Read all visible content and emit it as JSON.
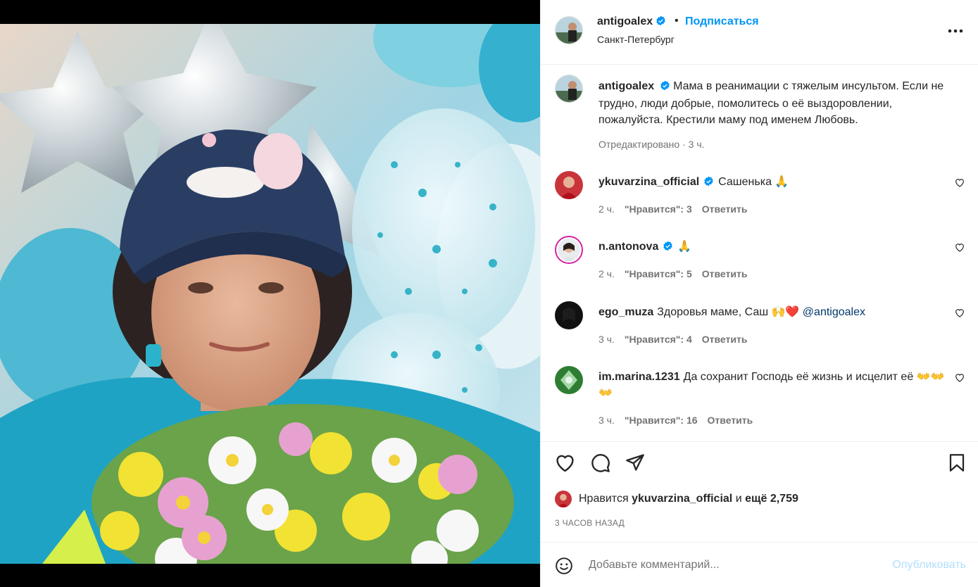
{
  "post": {
    "author": "antigoalex",
    "follow_label": "Подписаться",
    "separator": "•",
    "location": "Санкт-Петербург",
    "more_icon": "more-horizontal-icon"
  },
  "caption": {
    "author": "antigoalex",
    "text": "Мама в реанимации с тяжелым инсультом. Если не трудно, люди добрые, помолитесь о её выздоровлении, пожалуйста. Крестили маму под именем Любовь.",
    "edited": "Отредактировано",
    "dot": "·",
    "time": "3 ч."
  },
  "comments": [
    {
      "author": "ykuvarzina_official",
      "verified": true,
      "text": "Сашенька 🙏",
      "time": "2 ч.",
      "likes": "\"Нравится\": 3",
      "reply": "Ответить"
    },
    {
      "author": "n.antonova",
      "verified": true,
      "text": "🙏",
      "time": "2 ч.",
      "likes": "\"Нравится\": 5",
      "reply": "Ответить"
    },
    {
      "author": "ego_muza",
      "verified": false,
      "text": "Здоровья маме, Саш 🙌❤️",
      "mention": "@antigoalex",
      "time": "3 ч.",
      "likes": "\"Нравится\": 4",
      "reply": "Ответить"
    },
    {
      "author": "im.marina.1231",
      "verified": false,
      "text": "Да сохранит Господь её жизнь и исцелит её 👐👐👐",
      "time": "3 ч.",
      "likes": "\"Нравится\": 16",
      "reply": "Ответить"
    }
  ],
  "actions": {
    "like_icon": "heart-icon",
    "comment_icon": "comment-icon",
    "share_icon": "paper-plane-icon",
    "save_icon": "bookmark-icon"
  },
  "likes": {
    "prefix": "Нравится",
    "user": "ykuvarzina_official",
    "conj": "и",
    "more": "ещё 2,759"
  },
  "timestamp": "3 ЧАСОВ НАЗАД",
  "add_comment": {
    "placeholder": "Добавьте комментарий...",
    "publish_label": "Опубликовать"
  },
  "colors": {
    "link_blue": "#0095f6",
    "verified_blue": "#0095f6",
    "muted": "#737373",
    "publish_disabled": "#b2dffc"
  }
}
